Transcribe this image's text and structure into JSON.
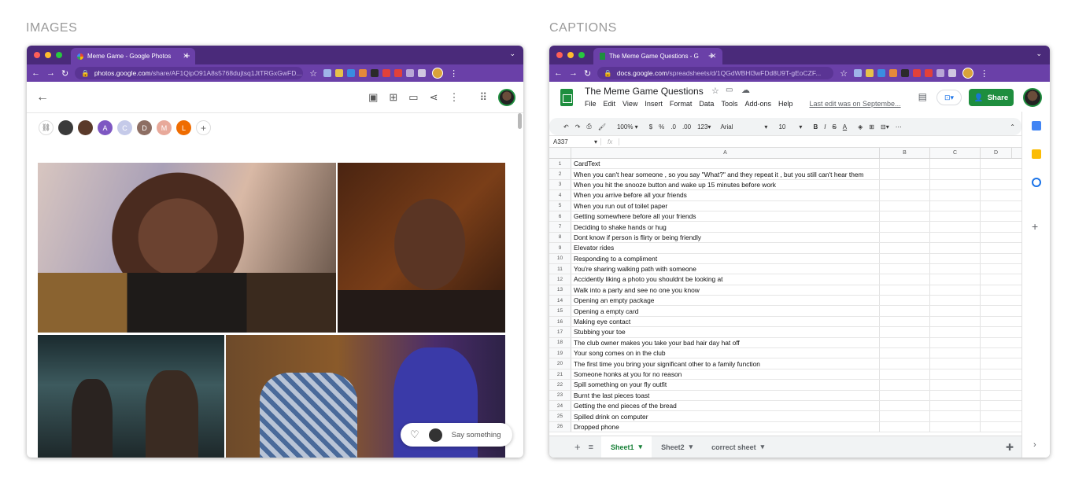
{
  "sections": {
    "images": "IMAGES",
    "captions": "CAPTIONS"
  },
  "photos_browser": {
    "tab_title": "Meme Game - Google Photos",
    "url_host": "photos.google.com",
    "url_path": "/share/AF1QipO91A8s5768dujtsq1JtTRGxGwFD...",
    "people_initials": [
      "A",
      "C",
      "D",
      "M",
      "L"
    ],
    "comment_placeholder": "Say something"
  },
  "sheets_browser": {
    "tab_title": "The Meme Game Questions - G",
    "url_host": "docs.google.com",
    "url_path": "/spreadsheets/d/1QGdWBHl3wFDd8U9T-gEoCZF...",
    "doc_title": "The Meme Game Questions",
    "menu": [
      "File",
      "Edit",
      "View",
      "Insert",
      "Format",
      "Data",
      "Tools",
      "Add-ons",
      "Help"
    ],
    "last_edit": "Last edit was on Septembe...",
    "share_label": "Share",
    "toolbar": {
      "zoom": "100%",
      "currency": "$",
      "percent": "%",
      "dec_less": ".0",
      "dec_more": ".00",
      "more_formats": "123",
      "font": "Arial",
      "font_size": "10"
    },
    "cell_ref": "A337",
    "fx": "fx",
    "columns": [
      "A",
      "B",
      "C",
      "D"
    ],
    "rows": [
      {
        "n": "1",
        "text": "CardText"
      },
      {
        "n": "2",
        "text": "When you can't hear someone , so you say \"What?\" and they repeat it , but you still can't hear them"
      },
      {
        "n": "3",
        "text": "When you hit the snooze button and wake up 15 minutes before work"
      },
      {
        "n": "4",
        "text": "When you arrive before all your friends"
      },
      {
        "n": "5",
        "text": "When you run out of toilet paper"
      },
      {
        "n": "6",
        "text": "Getting somewhere before all your friends"
      },
      {
        "n": "7",
        "text": "Deciding to shake hands or hug"
      },
      {
        "n": "8",
        "text": "Dont know if person is flirty or being friendly"
      },
      {
        "n": "9",
        "text": "Elevator rides"
      },
      {
        "n": "10",
        "text": "Responding to a compliment"
      },
      {
        "n": "11",
        "text": "You're sharing walking path with someone"
      },
      {
        "n": "12",
        "text": "Accidently liking a photo you shouldnt be looking at"
      },
      {
        "n": "13",
        "text": "Walk into a party and see no one you know"
      },
      {
        "n": "14",
        "text": "Opening an empty package"
      },
      {
        "n": "15",
        "text": "Opening a empty card"
      },
      {
        "n": "16",
        "text": "Making eye contact"
      },
      {
        "n": "17",
        "text": "Stubbing your toe"
      },
      {
        "n": "18",
        "text": "The club owner makes you take your bad hair day hat off"
      },
      {
        "n": "19",
        "text": "Your song comes on in the club"
      },
      {
        "n": "20",
        "text": "The first time you bring your significant other to a family function"
      },
      {
        "n": "21",
        "text": "Someone honks at you for no reason"
      },
      {
        "n": "22",
        "text": "Spill something on your fly outfit"
      },
      {
        "n": "23",
        "text": "Burnt the last pieces toast"
      },
      {
        "n": "24",
        "text": "Getting the end pieces of the bread"
      },
      {
        "n": "25",
        "text": "Spilled drink on computer"
      },
      {
        "n": "26",
        "text": "Dropped phone"
      }
    ],
    "sheet_tabs": [
      "Sheet1",
      "Sheet2",
      "correct sheet"
    ]
  },
  "colors": {
    "chrome_dark": "#4a2a7a",
    "chrome": "#6a40a8",
    "sheets_green": "#1e8e3e"
  }
}
